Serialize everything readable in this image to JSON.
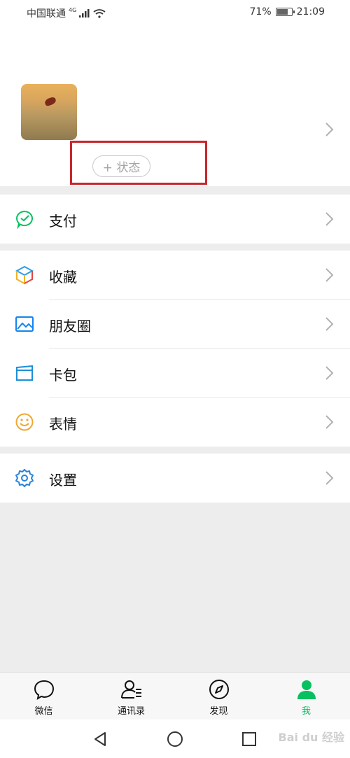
{
  "status_bar": {
    "carrier": "中国联通",
    "network": "4G",
    "battery": "71%",
    "time": "21:09"
  },
  "profile": {
    "status_button": "+ 状态",
    "chevron_icon": "chevron-right-icon"
  },
  "menu": {
    "pay": {
      "label": "支付",
      "icon": "pay-icon"
    },
    "items": [
      {
        "label": "收藏",
        "icon": "favorites-icon"
      },
      {
        "label": "朋友圈",
        "icon": "moments-icon"
      },
      {
        "label": "卡包",
        "icon": "card-wallet-icon"
      },
      {
        "label": "表情",
        "icon": "sticker-icon"
      }
    ],
    "settings": {
      "label": "设置",
      "icon": "settings-icon"
    }
  },
  "tabbar": {
    "tabs": [
      {
        "label": "微信",
        "icon": "chat-icon",
        "active": false
      },
      {
        "label": "通讯录",
        "icon": "contacts-icon",
        "active": false
      },
      {
        "label": "发现",
        "icon": "discover-icon",
        "active": false
      },
      {
        "label": "我",
        "icon": "me-icon",
        "active": true
      }
    ]
  },
  "colors": {
    "accent": "#07c160",
    "highlight_box": "#c8262c"
  },
  "watermark": "Bai du 经验"
}
